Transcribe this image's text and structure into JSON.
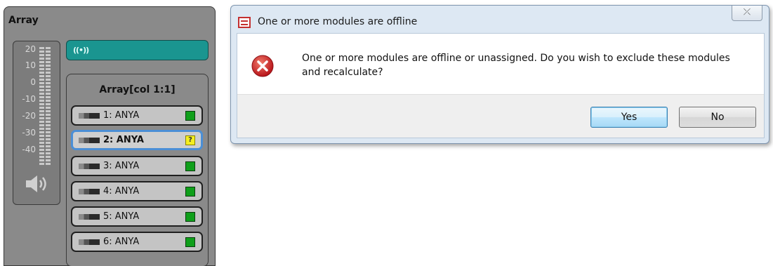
{
  "array_panel": {
    "title": "Array",
    "meter": {
      "labels": [
        "20",
        "10",
        "0",
        "-10",
        "-20",
        "-30",
        "-40"
      ]
    },
    "status_icon": "((•))",
    "column_group": {
      "title": "Array[col 1:1]",
      "modules": [
        {
          "label": "1: ANYA",
          "status": "ok"
        },
        {
          "label": "2: ANYA",
          "status": "unknown",
          "status_glyph": "?",
          "selected": true
        },
        {
          "label": "3: ANYA",
          "status": "ok"
        },
        {
          "label": "4: ANYA",
          "status": "ok"
        },
        {
          "label": "5: ANYA",
          "status": "ok"
        },
        {
          "label": "6: ANYA",
          "status": "ok"
        }
      ]
    }
  },
  "dialog": {
    "title": "One or more modules are offline",
    "close_glyph": "⤫",
    "message": "One or more modules are offline or unassigned. Do you wish to exclude these modules and recalculate?",
    "buttons": {
      "yes": "Yes",
      "no": "No"
    }
  },
  "colors": {
    "panel_bg": "#8a8a8a",
    "status_bar": "#1a9590",
    "led_ok": "#0f9f1a",
    "led_warn": "#f5ef20",
    "selection": "#4b8fd6",
    "error_red": "#d42a2a"
  }
}
